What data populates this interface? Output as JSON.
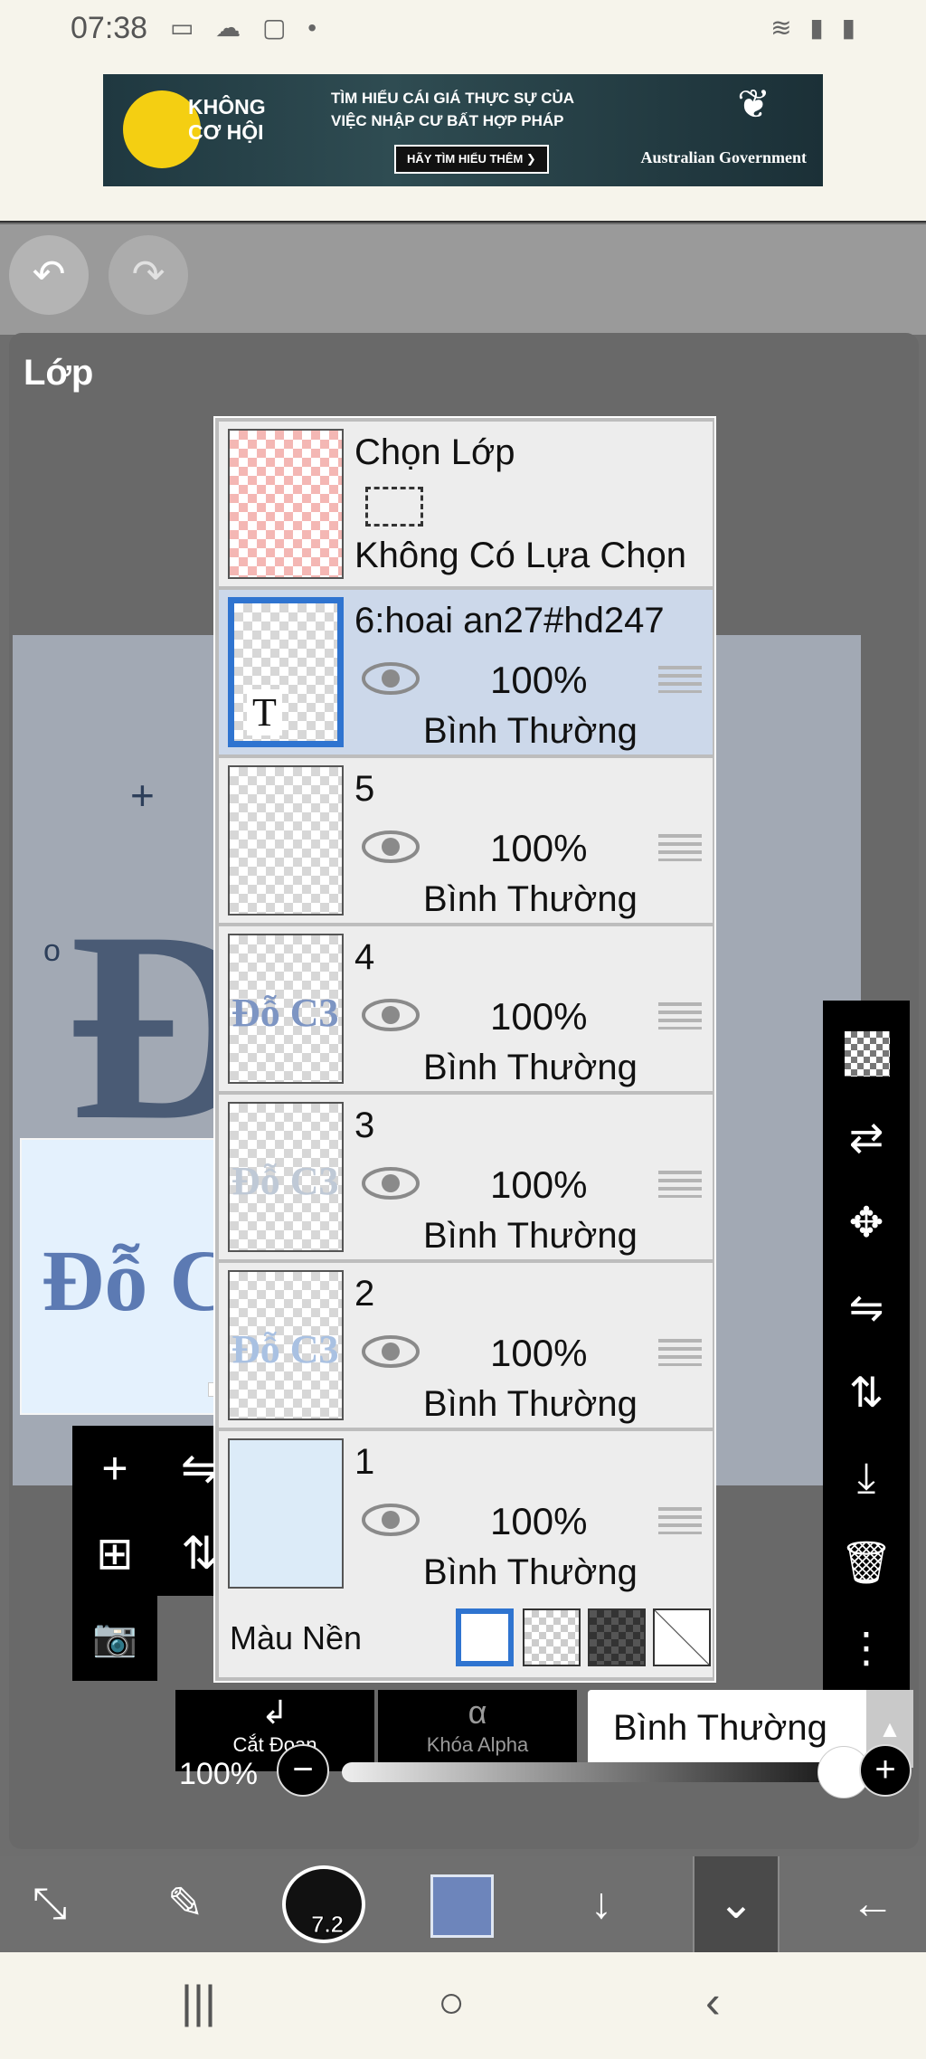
{
  "status_bar": {
    "time": "07:38",
    "left_icons": "▭ ☁ ▢ •",
    "right_icons": "≋ ▮ ▮"
  },
  "ad": {
    "logo_text_line1": "KHÔNG",
    "logo_text_line2": "CƠ HỘI",
    "copy_line1": "TÌM HIỂU CÁI GIÁ THỰC SỰ CỦA",
    "copy_line2": "VIỆC NHẬP CƯ BẤT HỢP PHÁP",
    "cta": "HÃY TÌM HIỂU THÊM ❯",
    "sponsor": "Australian Government"
  },
  "toolbar_top": {
    "undo_icon": "↶",
    "redo_icon": "↷"
  },
  "layer_panel": {
    "title": "Lớp",
    "selection_row": {
      "title": "Chọn Lớp",
      "status": "Không Có Lựa Chọn"
    },
    "layers": [
      {
        "name": "6:hoai an27#hd247",
        "opacity": "100%",
        "mode": "Bình Thường",
        "selected": true,
        "thumb_text": "T",
        "thumb_art": ""
      },
      {
        "name": "5",
        "opacity": "100%",
        "mode": "Bình Thường",
        "selected": false,
        "thumb_text": "",
        "thumb_art": ""
      },
      {
        "name": "4",
        "opacity": "100%",
        "mode": "Bình Thường",
        "selected": false,
        "thumb_text": "",
        "thumb_art": "Đỗ C3"
      },
      {
        "name": "3",
        "opacity": "100%",
        "mode": "Bình Thường",
        "selected": false,
        "thumb_text": "",
        "thumb_art": "Đỗ C3"
      },
      {
        "name": "2",
        "opacity": "100%",
        "mode": "Bình Thường",
        "selected": false,
        "thumb_text": "",
        "thumb_art": "Đỗ C3"
      },
      {
        "name": "1",
        "opacity": "100%",
        "mode": "Bình Thường",
        "selected": false,
        "thumb_text": "",
        "thumb_art": ""
      }
    ],
    "background": {
      "label": "Màu Nền",
      "options": [
        "white",
        "transparent",
        "dark-checker",
        "none"
      ],
      "selected": "white"
    }
  },
  "canvas": {
    "art_text": "Đỗ",
    "preview_text": "Đỗ C3"
  },
  "left_tools": {
    "add_layer": "+",
    "add_copy": "⊞",
    "camera": "📷",
    "flip_h": "⇋",
    "flip_v": "⇅"
  },
  "right_tools": [
    "checker",
    "⇄",
    "✥",
    "⇋",
    "⇅",
    "⤓",
    "🗑",
    "⋮"
  ],
  "bottom_actions": {
    "clip_label": "Cắt Đoạn",
    "clip_icon": "↲",
    "alpha_lock_label": "Khóa Alpha",
    "alpha_lock_icon": "α",
    "blend_mode": "Bình Thường",
    "blend_arrow": "▲"
  },
  "opacity_control": {
    "value": "100%",
    "value_fraction": 1.0,
    "minus": "−",
    "plus": "+"
  },
  "bottom_toolbar": {
    "brush_size": "7.2",
    "color": "#6d85bb",
    "transform_icon": "⤡",
    "brush_icon": "✎",
    "down_icon": "↓",
    "layers_icon": "⌄",
    "back_icon": "←"
  },
  "nav_bar": {
    "recent": "|||",
    "home": "○",
    "back": "‹"
  }
}
